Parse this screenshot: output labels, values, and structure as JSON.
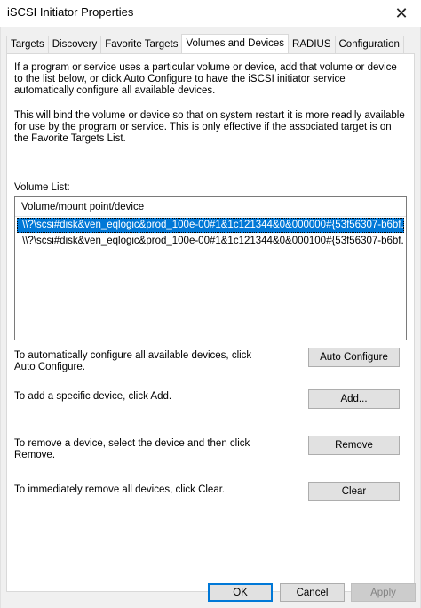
{
  "window": {
    "title": "iSCSI Initiator Properties",
    "close_glyph": "✕"
  },
  "tabs": [
    {
      "label": "Targets",
      "active": false
    },
    {
      "label": "Discovery",
      "active": false
    },
    {
      "label": "Favorite Targets",
      "active": false
    },
    {
      "label": "Volumes and Devices",
      "active": true
    },
    {
      "label": "RADIUS",
      "active": false
    },
    {
      "label": "Configuration",
      "active": false
    }
  ],
  "panel": {
    "intro": "If a program or service uses a particular volume or device, add that volume or device to the list below, or click Auto Configure to have the iSCSI initiator service automatically configure all available devices.",
    "bind_note": "This will bind the volume or device so that on system restart it is more readily available for use by the program or service.  This is only effective if the associated target is on the Favorite Targets List.",
    "volume_list_label": "Volume List:",
    "list_column_header": "Volume/mount point/device",
    "volumes": [
      {
        "text": "\\\\?\\scsi#disk&ven_eqlogic&prod_100e-00#1&1c121344&0&000000#{53f56307-b6bf...",
        "selected": true
      },
      {
        "text": "\\\\?\\scsi#disk&ven_eqlogic&prod_100e-00#1&1c121344&0&000100#{53f56307-b6bf...",
        "selected": false
      }
    ],
    "actions": {
      "auto_configure_text": "To automatically configure all available devices, click Auto Configure.",
      "auto_configure_button": "Auto Configure",
      "add_text": "To add a specific device, click Add.",
      "add_button": "Add...",
      "remove_text": "To remove a device, select the device and then click Remove.",
      "remove_button": "Remove",
      "clear_text": "To immediately remove all devices, click Clear.",
      "clear_button": "Clear"
    }
  },
  "footer": {
    "ok": "OK",
    "cancel": "Cancel",
    "apply": "Apply"
  },
  "colors": {
    "selection": "#0078d7",
    "dialog_bg": "#f0f0f0",
    "button_bg": "#e1e1e1"
  }
}
